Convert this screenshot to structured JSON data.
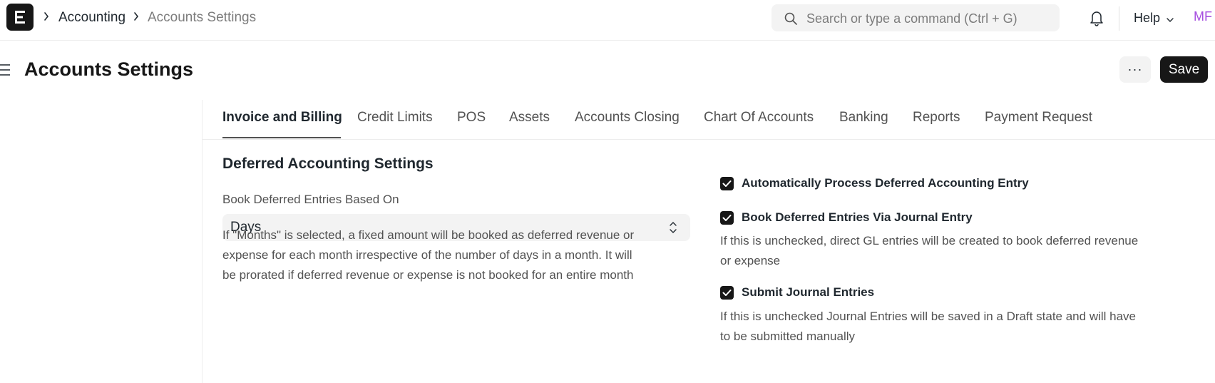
{
  "navbar": {
    "logo_letter": "E",
    "breadcrumbs": [
      "Accounting",
      "Accounts Settings"
    ],
    "search_placeholder": "Search or type a command (Ctrl + G)",
    "help_label": "Help",
    "avatar_initials": "MF"
  },
  "page": {
    "title": "Accounts Settings",
    "more_label": "···",
    "save_label": "Save"
  },
  "tabs": [
    {
      "label": "Invoice and Billing",
      "active": true
    },
    {
      "label": "Credit Limits"
    },
    {
      "label": "POS"
    },
    {
      "label": "Assets"
    },
    {
      "label": "Accounts Closing"
    },
    {
      "label": "Chart Of Accounts"
    },
    {
      "label": "Banking"
    },
    {
      "label": "Reports"
    },
    {
      "label": "Payment Request"
    }
  ],
  "section": {
    "title": "Deferred Accounting Settings",
    "book_deferred": {
      "label": "Book Deferred Entries Based On",
      "value": "Days",
      "description_lines": [
        "If \"Months\" is selected, a fixed amount will be booked as deferred revenue or",
        "expense for each month irrespective of the number of days in a month. It will",
        "be prorated if deferred revenue or expense is not booked for an entire month"
      ]
    },
    "checks": [
      {
        "label": "Automatically Process Deferred Accounting Entry",
        "checked": true,
        "description_lines": []
      },
      {
        "label": "Book Deferred Entries Via Journal Entry",
        "checked": true,
        "description_lines": [
          "If this is unchecked, direct GL entries will be created to book deferred revenue",
          "or expense"
        ]
      },
      {
        "label": "Submit Journal Entries",
        "checked": true,
        "description_lines": [
          "If this is unchecked Journal Entries will be saved in a Draft state and will have",
          "to be submitted manually"
        ]
      }
    ]
  },
  "colors": {
    "primary_dark": "#171717",
    "text": "#1f272e",
    "muted": "#7c7c7c",
    "control_bg": "#f3f3f3",
    "avatar": "#a64ee0"
  }
}
